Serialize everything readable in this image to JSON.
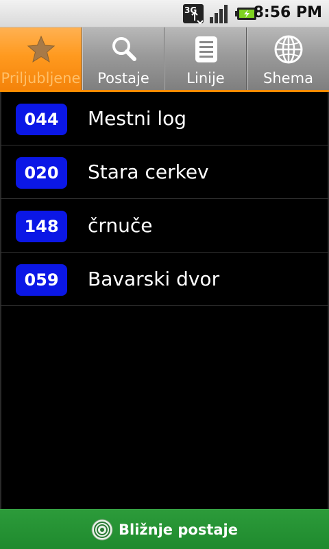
{
  "status_bar": {
    "time": "8:56 PM",
    "network_label": "3G",
    "icons": [
      "3g-data-icon",
      "signal-strength-icon",
      "battery-charging-icon"
    ]
  },
  "tabs": [
    {
      "label": "Priljubljene",
      "icon": "star-icon",
      "active": true
    },
    {
      "label": "Postaje",
      "icon": "search-icon",
      "active": false
    },
    {
      "label": "Linije",
      "icon": "list-icon",
      "active": false
    },
    {
      "label": "Shema",
      "icon": "globe-icon",
      "active": false
    }
  ],
  "favorites": [
    {
      "code": "044",
      "name": "Mestni log"
    },
    {
      "code": "020",
      "name": "Stara cerkev"
    },
    {
      "code": "148",
      "name": "črnuče"
    },
    {
      "code": "059",
      "name": "Bavarski dvor"
    }
  ],
  "bottom_bar": {
    "label": "Bližnje postaje",
    "icon": "location-target-icon"
  },
  "colors": {
    "active_tab": "#ff9a1f",
    "badge": "#0b17e6",
    "bottom_bar": "#249339",
    "background": "#000000"
  }
}
